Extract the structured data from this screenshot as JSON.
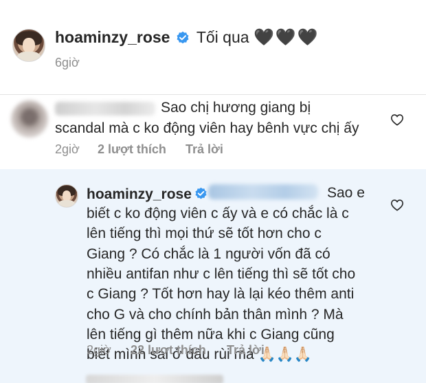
{
  "caption": {
    "username": "hoaminzy_rose",
    "text": "Tối qua",
    "hearts": "🖤🖤🖤",
    "time": "6giờ"
  },
  "comment": {
    "text_line1": "Sao chị hương giang bị",
    "text_line2": "scandal mà c ko động viên hay bênh vực chị ấy",
    "time": "2giờ",
    "likes": "2 lượt thích",
    "reply_label": "Trả lời"
  },
  "reply": {
    "username": "hoaminzy_rose",
    "lines": [
      "Sao e",
      "biết c ko động viên c ấy và e có chắc là c",
      "lên tiếng thì mọi thứ sẽ tốt hơn cho c",
      "Giang ? Có chắc là 1 người vốn đã có",
      "nhiều antifan như c lên tiếng thì sẽ tốt cho",
      "c Giang ? Tốt hơn hay là lại kéo thêm anti",
      "cho G và cho chính bản thân mình ? Mà",
      "lên tiếng gì thêm nữa khi c Giang cũng",
      "biết mình sai ở đâu rùi mà 🙏🏻🙏🏻🙏🏻"
    ],
    "time": "2giờ",
    "likes": "22 lượt thích",
    "reply_label": "Trả lời"
  },
  "colors": {
    "verified_blue": "#3897f0",
    "meta_gray": "#8e8e8e",
    "reply_bg": "#eef5fc"
  },
  "icons": {
    "verified": "verified-badge-icon",
    "like": "heart-outline-icon"
  }
}
